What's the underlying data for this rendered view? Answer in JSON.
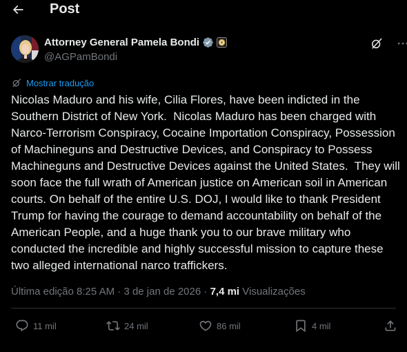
{
  "header": {
    "title": "Post"
  },
  "author": {
    "display_name": "Attorney General Pamela Bondi",
    "handle": "@AGPamBondi"
  },
  "translation": {
    "label": "Mostrar tradução"
  },
  "tweet": {
    "text": "Nicolas Maduro and his wife, Cilia Flores, have been indicted in the Southern District of New York.  Nicolas Maduro has been charged with Narco-Terrorism Conspiracy, Cocaine Importation Conspiracy, Possession of Machineguns and Destructive Devices, and Conspiracy to Possess Machineguns and Destructive Devices against the United States.  They will soon face the full wrath of American justice on American soil in American courts. On behalf of the entire U.S. DOJ, I would like to thank President Trump for having the courage to demand accountability on behalf of the American People, and a huge thank you to our brave military who conducted the incredible and highly successful mission to capture these two alleged international narco traffickers."
  },
  "meta": {
    "edited_prefix": "Última edição",
    "time": "8:25 AM",
    "separator": "·",
    "date": "3 de jan de 2026",
    "views_count": "7,4 mi",
    "views_label": "Visualizações"
  },
  "actions": {
    "replies": "11 mil",
    "reposts": "24 mil",
    "likes": "86 mil",
    "bookmarks": "4 mil"
  },
  "colors": {
    "background": "#000000",
    "text": "#e7e9ea",
    "muted": "#71767b",
    "link": "#1d9bf0",
    "verified": "#829aab"
  },
  "icons": {
    "back": "arrow-left-icon",
    "verified": "verified-badge-icon",
    "affiliate": "affiliate-seal-icon",
    "grok": "grok-icon",
    "more": "more-icon",
    "translate": "translate-icon",
    "reply": "reply-icon",
    "repost": "repost-icon",
    "like": "heart-icon",
    "bookmark": "bookmark-icon",
    "share": "share-icon"
  }
}
